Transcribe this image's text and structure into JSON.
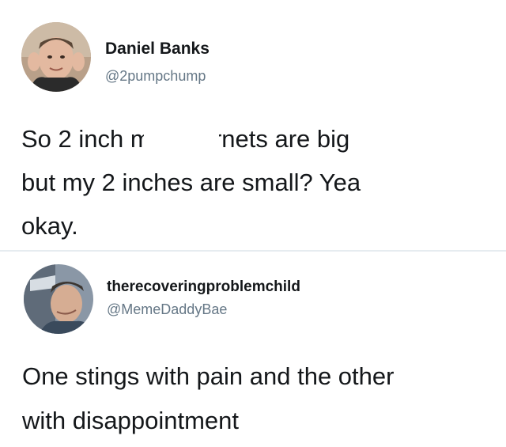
{
  "tweets": [
    {
      "author_name": "Daniel Banks",
      "author_handle": "@2pumpchump",
      "text": "So 2 inch m     er hornets are big\nbut my 2 inches are small? Yea\nokay."
    },
    {
      "author_name": "therecoveringproblemchild",
      "author_handle": "@MemeDaddyBae",
      "text": "One stings with pain and the other\nwith disappointment"
    }
  ],
  "colors": {
    "text_primary": "#14171a",
    "text_secondary": "#657786",
    "divider": "#e6ecf0"
  },
  "icons": {
    "tweet_1_avatar": "profile-photo",
    "tweet_2_avatar": "profile-photo"
  }
}
